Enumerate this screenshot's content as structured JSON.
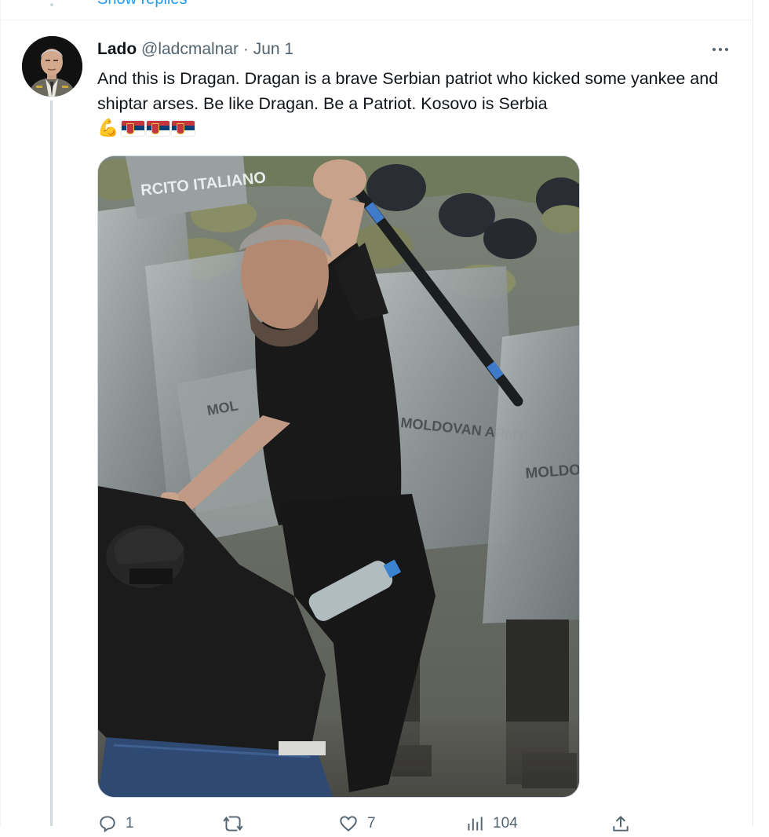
{
  "previous_reply": {
    "show_replies_label": "Show replies"
  },
  "tweet": {
    "display_name": "Lado",
    "handle": "@ladcmalnar",
    "separator": "·",
    "date": "Jun 1",
    "text": "And this is Dragan. Dragan is a brave Serbian patriot who kicked some yankee and shiptar arses. Be like Dragan. Be a Patriot. Kosovo is Serbia",
    "emojis": {
      "muscle": "💪",
      "flags": [
        "serbia-flag",
        "serbia-flag",
        "serbia-flag"
      ]
    },
    "more_icon": "more-horizontal-icon",
    "media_description_icon": "photo",
    "stats": {
      "replies": "1",
      "retweets": "",
      "likes": "7",
      "views": "104"
    }
  },
  "colors": {
    "text_primary": "#0f1419",
    "text_secondary": "#536471",
    "accent": "#1d9bf0",
    "border": "#cfd9de"
  }
}
